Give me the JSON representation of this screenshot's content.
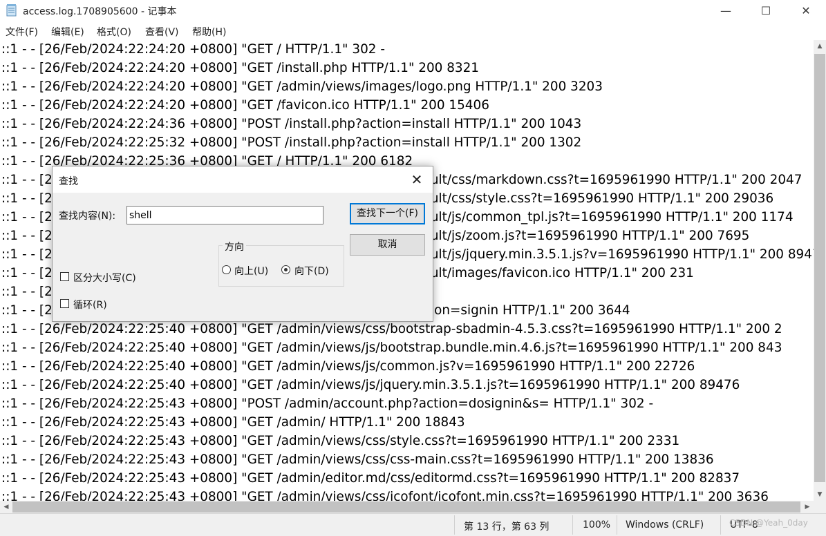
{
  "window": {
    "title": "access.log.1708905600 - 记事本",
    "minimize": "—",
    "maximize": "☐",
    "close": "✕"
  },
  "menu": [
    "文件(F)",
    "编辑(E)",
    "格式(O)",
    "查看(V)",
    "帮助(H)"
  ],
  "lines": [
    "::1 - - [26/Feb/2024:22:24:20 +0800] \"GET / HTTP/1.1\" 302 -",
    "::1 - - [26/Feb/2024:22:24:20 +0800] \"GET /install.php HTTP/1.1\" 200 8321",
    "::1 - - [26/Feb/2024:22:24:20 +0800] \"GET /admin/views/images/logo.png HTTP/1.1\" 200 3203",
    "::1 - - [26/Feb/2024:22:24:20 +0800] \"GET /favicon.ico HTTP/1.1\" 200 15406",
    "::1 - - [26/Feb/2024:22:24:36 +0800] \"POST /install.php?action=install HTTP/1.1\" 200 1043",
    "::1 - - [26/Feb/2024:22:25:32 +0800] \"POST /install.php?action=install HTTP/1.1\" 200 1302",
    "::1 - - [26/Feb/2024:22:25:36 +0800] \"GET / HTTP/1.1\" 200 6182",
    "::1 - - [26/Feb/2024:22:25:36 +0800] \"GET /content/templates/default/css/markdown.css?t=1695961990 HTTP/1.1\" 200 2047",
    "::1 - - [26/Feb/2024:22:25:36 +0800] \"GET /content/templates/default/css/style.css?t=1695961990 HTTP/1.1\" 200 29036",
    "::1 - - [26/Feb/2024:22:25:36 +0800] \"GET /content/templates/default/js/common_tpl.js?t=1695961990 HTTP/1.1\" 200 1174",
    "::1 - - [26/Feb/2024:22:25:36 +0800] \"GET /content/templates/default/js/zoom.js?t=1695961990 HTTP/1.1\" 200 7695",
    "::1 - - [26/Feb/2024:22:25:36 +0800] \"GET /content/templates/default/js/jquery.min.3.5.1.js?v=1695961990 HTTP/1.1\" 200 89476",
    "::1 - - [26/Feb/2024:22:25:36 +0800] \"GET /content/templates/default/images/favicon.ico HTTP/1.1\" 200 231",
    "::1 - - [26/Feb/2024:22:25:40 +0800] \"GET /admin/ HTTP/1.1\" 302 -",
    "::1 - - [26/Feb/2024:22:25:40 +0800] \"GET /admin/account.php?action=signin HTTP/1.1\" 200 3644",
    "::1 - - [26/Feb/2024:22:25:40 +0800] \"GET /admin/views/css/bootstrap-sbadmin-4.5.3.css?t=1695961990 HTTP/1.1\" 200 2",
    "::1 - - [26/Feb/2024:22:25:40 +0800] \"GET /admin/views/js/bootstrap.bundle.min.4.6.js?t=1695961990 HTTP/1.1\" 200 843",
    "::1 - - [26/Feb/2024:22:25:40 +0800] \"GET /admin/views/js/common.js?v=1695961990 HTTP/1.1\" 200 22726",
    "::1 - - [26/Feb/2024:22:25:40 +0800] \"GET /admin/views/js/jquery.min.3.5.1.js?t=1695961990 HTTP/1.1\" 200 89476",
    "::1 - - [26/Feb/2024:22:25:43 +0800] \"POST /admin/account.php?action=dosignin&s= HTTP/1.1\" 302 -",
    "::1 - - [26/Feb/2024:22:25:43 +0800] \"GET /admin/ HTTP/1.1\" 200 18843",
    "::1 - - [26/Feb/2024:22:25:43 +0800] \"GET /admin/views/css/style.css?t=1695961990 HTTP/1.1\" 200 2331",
    "::1 - - [26/Feb/2024:22:25:43 +0800] \"GET /admin/views/css/css-main.css?t=1695961990 HTTP/1.1\" 200 13836",
    "::1 - - [26/Feb/2024:22:25:43 +0800] \"GET /admin/editor.md/css/editormd.css?t=1695961990 HTTP/1.1\" 200 82837",
    "::1 - - [26/Feb/2024:22:25:43 +0800] \"GET /admin/views/css/icofont/icofont.min.css?t=1695961990 HTTP/1.1\" 200 3636"
  ],
  "find_dialog": {
    "title": "查找",
    "close": "✕",
    "find_label": "查找内容(N):",
    "find_value": "shell",
    "find_next": "查找下一个(F)",
    "cancel": "取消",
    "direction_label": "方向",
    "up": "向上(U)",
    "down": "向下(D)",
    "direction_selected": "down",
    "match_case": "区分大小写(C)",
    "wrap": "循环(R)"
  },
  "status": {
    "position": "第 13 行，第 63 列",
    "zoom": "100%",
    "eol": "Windows (CRLF)",
    "encoding": "UTF-8"
  },
  "watermark": "CSDN @Yeah_0day"
}
